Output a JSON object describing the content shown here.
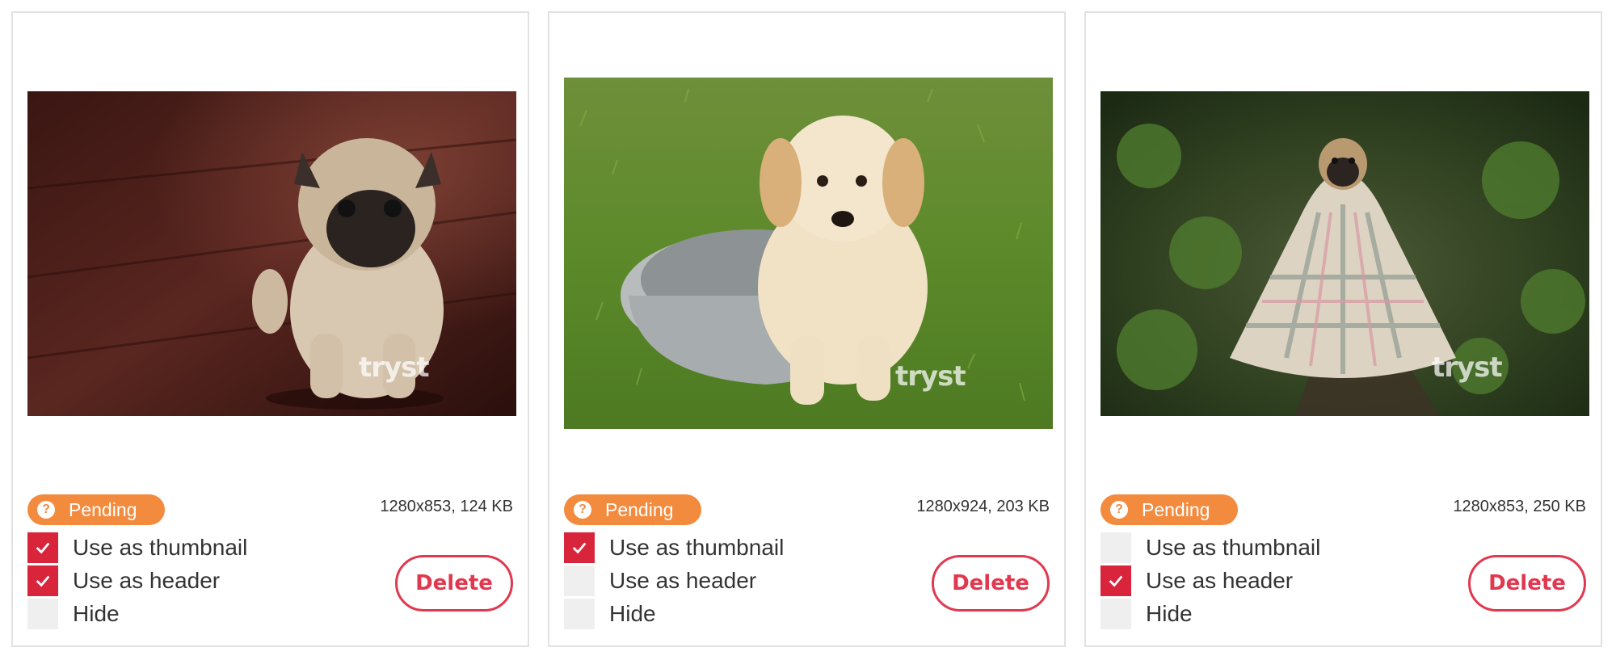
{
  "cards": [
    {
      "status": "Pending",
      "meta": "1280x853, 124 KB",
      "watermark": "tryst",
      "options": [
        {
          "label": "Use as thumbnail",
          "checked": true
        },
        {
          "label": "Use as header",
          "checked": true
        },
        {
          "label": "Hide",
          "checked": false
        }
      ],
      "delete_label": "Delete"
    },
    {
      "status": "Pending",
      "meta": "1280x924, 203 KB",
      "watermark": "tryst",
      "options": [
        {
          "label": "Use as thumbnail",
          "checked": true
        },
        {
          "label": "Use as header",
          "checked": false
        },
        {
          "label": "Hide",
          "checked": false
        }
      ],
      "delete_label": "Delete"
    },
    {
      "status": "Pending",
      "meta": "1280x853, 250 KB",
      "watermark": "tryst",
      "options": [
        {
          "label": "Use as thumbnail",
          "checked": false
        },
        {
          "label": "Use as header",
          "checked": true
        },
        {
          "label": "Hide",
          "checked": false
        }
      ],
      "delete_label": "Delete"
    }
  ],
  "colors": {
    "accent": "#d9253c",
    "badge": "#f38b3f",
    "delete": "#e0394f"
  },
  "icons": {
    "status": "question-circle-icon",
    "checkbox": "checkmark-icon"
  }
}
